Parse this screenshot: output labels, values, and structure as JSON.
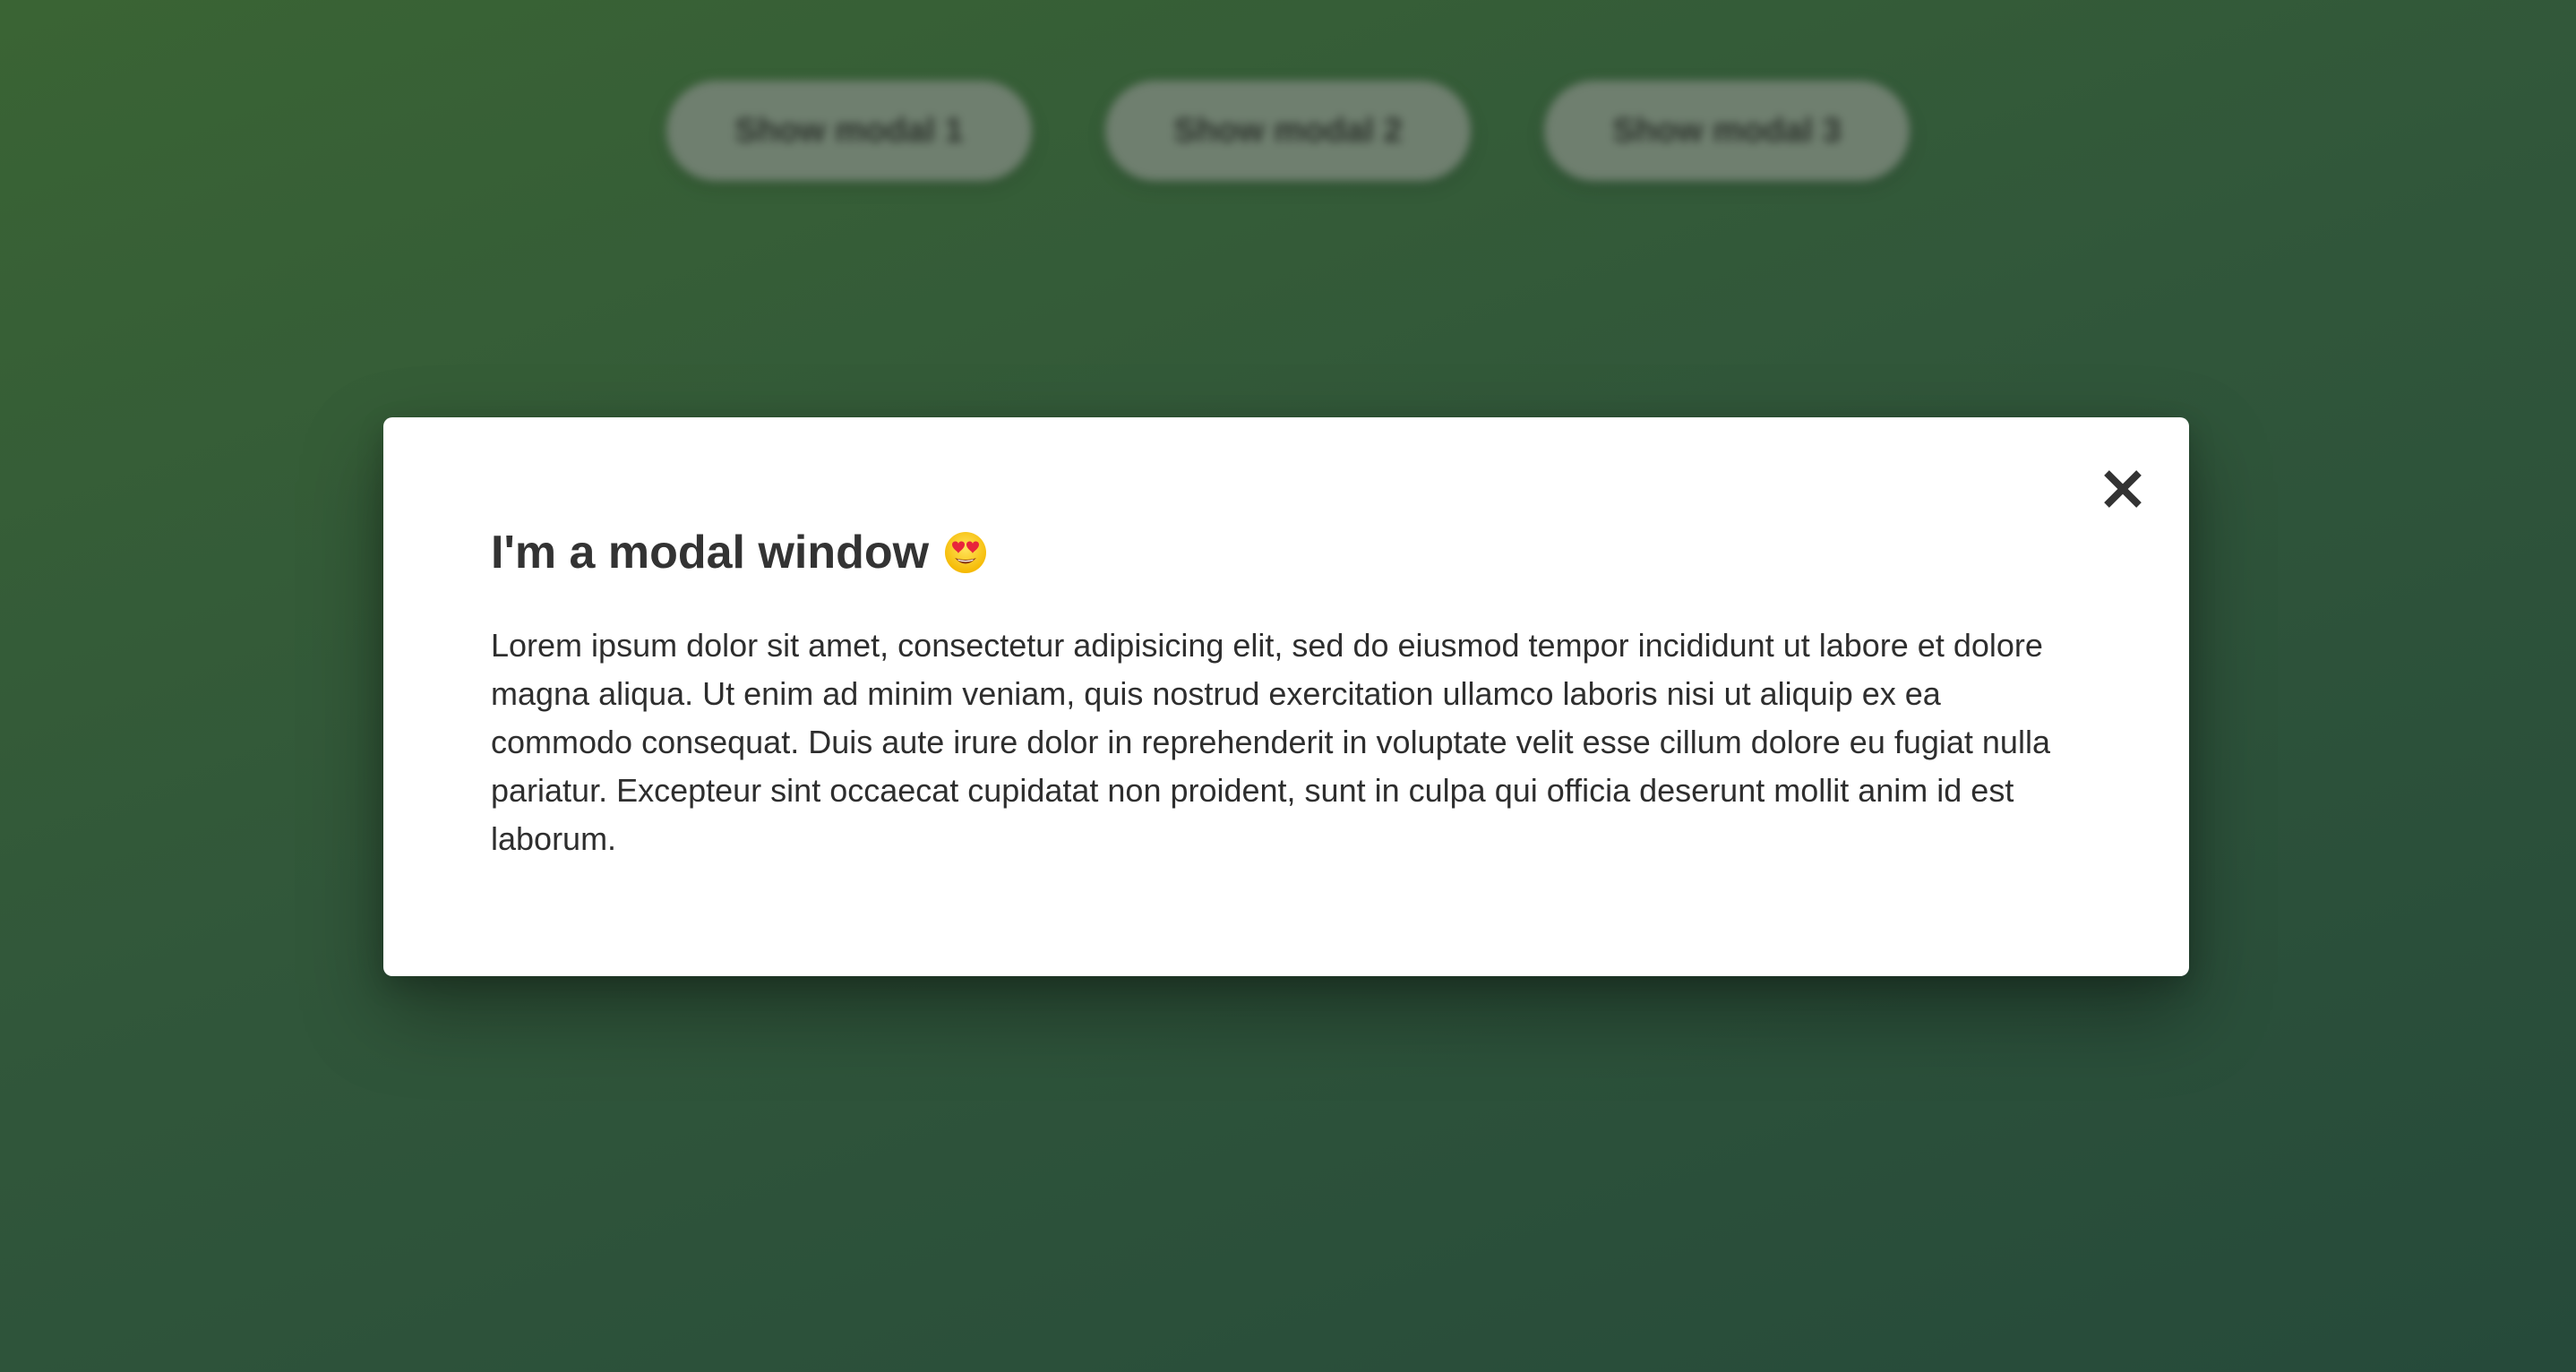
{
  "background": {
    "buttons": [
      {
        "label": "Show modal 1"
      },
      {
        "label": "Show modal 2"
      },
      {
        "label": "Show modal 3"
      }
    ]
  },
  "modal": {
    "title": "I'm a modal window",
    "title_icon": "heart-eyes-emoji-icon",
    "close_icon": "close-icon",
    "body": "Lorem ipsum dolor sit amet, consectetur adipisicing elit, sed do eiusmod tempor incididunt ut labore et dolore magna aliqua. Ut enim ad minim veniam, quis nostrud exercitation ullamco laboris nisi ut aliquip ex ea commodo consequat. Duis aute irure dolor in reprehenderit in voluptate velit esse cillum dolore eu fugiat nulla pariatur. Excepteur sint occaecat cupidatat non proident, sunt in culpa qui officia deserunt mollit anim id est laborum."
  },
  "colors": {
    "background_start": "#3a6434",
    "background_end": "#264a3a",
    "modal_bg": "#ffffff",
    "text": "#333333"
  }
}
